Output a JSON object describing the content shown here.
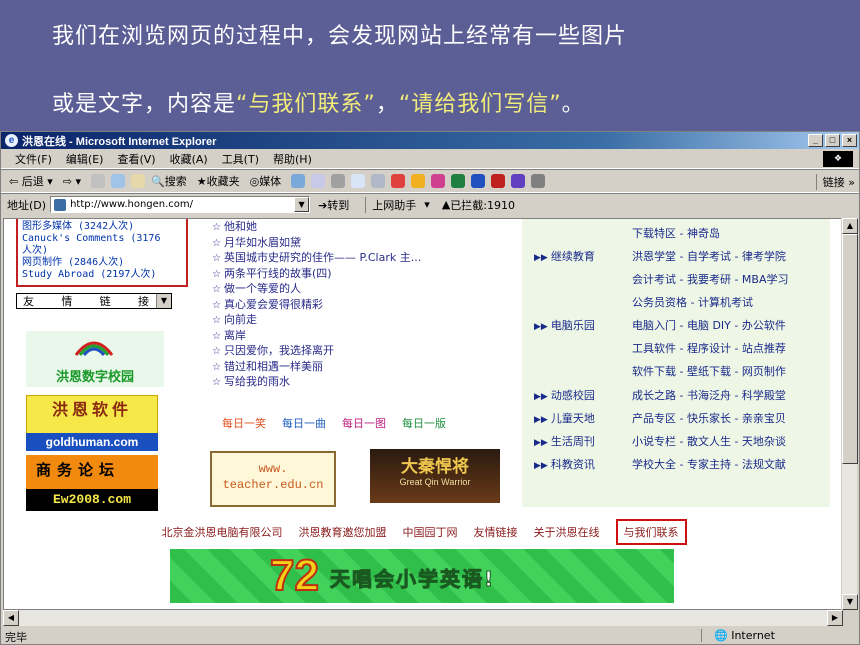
{
  "caption": {
    "line1": "我们在浏览网页的过程中，会发现网站上经常有一些图片",
    "line2_pre": "或是文字，内容是",
    "line2_q1": "“与我们联系”",
    "line2_mid": "，",
    "line2_q2": "“请给我们写信”",
    "line2_post": "。"
  },
  "window": {
    "title": "洪恩在线 - Microsoft Internet Explorer",
    "ctrl_min": "_",
    "ctrl_max": "□",
    "ctrl_close": "×"
  },
  "menu": [
    "文件(F)",
    "编辑(E)",
    "查看(V)",
    "收藏(A)",
    "工具(T)",
    "帮助(H)"
  ],
  "toolbar": {
    "back": "后退",
    "search": "搜索",
    "favorites": "收藏夹",
    "media": "媒体",
    "links": "链接"
  },
  "addressbar": {
    "label": "地址(D)",
    "url": "http://www.hongen.com/",
    "go": "转到",
    "assistant": "上网助手",
    "blocked": "已拦截:1910"
  },
  "left": {
    "stats": [
      "图形多媒体 (3242人次)",
      "Canuck's Comments (3176",
      "人次)",
      "网页制作 (2846人次)",
      "Study Abroad (2197人次)"
    ],
    "friend_links": [
      "友",
      "情",
      "链",
      "接"
    ],
    "logo_school": "洪恩数字校园",
    "logo_soft": "洪恩软件",
    "logo_gold": "goldhuman.com",
    "logo_forum": "商务论坛",
    "logo_forum_url": "Ew2008.com"
  },
  "articles": [
    "他和她",
    "月华如水眉如黛",
    "英国城市史研究的佳作—— P.Clark 主...",
    "两条平行线的故事(四)",
    "做一个等爱的人",
    "真心爱会爱得很精彩",
    "向前走",
    "离岸",
    "只因爱你，我选择离开",
    "错过和相遇一样美丽",
    "写给我的雨水"
  ],
  "daily": [
    "每日一笑",
    "每日一曲",
    "每日一图",
    "每日一版"
  ],
  "banners": {
    "teacher_1": "www.",
    "teacher_2": "teacher.edu.cn",
    "qin_title": "大秦悍将",
    "qin_sub": "Great Qin Warrior",
    "english_num": "72",
    "english_msg": "天唱会小学英语!"
  },
  "right": [
    {
      "cat": "",
      "items": "下载特区 - 神奇岛"
    },
    {
      "cat": "继续教育",
      "items": "洪恩学堂 - 自学考试 - 律考学院"
    },
    {
      "cat": "",
      "items": "会计考试 - 我要考研 - MBA学习"
    },
    {
      "cat": "",
      "items": "公务员资格 - 计算机考试"
    },
    {
      "cat": "电脑乐园",
      "items": "电脑入门 - 电脑 DIY - 办公软件"
    },
    {
      "cat": "",
      "items": "工具软件 - 程序设计 - 站点推荐"
    },
    {
      "cat": "",
      "items": "软件下载 - 壁纸下载 - 网页制作"
    },
    {
      "cat": "动感校园",
      "items": "成长之路 - 书海泛舟 - 科学殿堂"
    },
    {
      "cat": "儿童天地",
      "items": "产品专区 - 快乐家长 - 亲亲宝贝"
    },
    {
      "cat": "生活周刊",
      "items": "小说专栏 - 散文人生 - 天地杂谈"
    },
    {
      "cat": "科教资讯",
      "items": "学校大全 - 专家主持 - 法规文献"
    }
  ],
  "footer": {
    "links": [
      "北京金洪恩电脑有限公司",
      "洪恩教育邀您加盟",
      "中国园丁网",
      "友情链接",
      "关于洪恩在线"
    ],
    "contact": "与我们联系"
  },
  "status": {
    "left": "完毕",
    "zone": "Internet"
  }
}
